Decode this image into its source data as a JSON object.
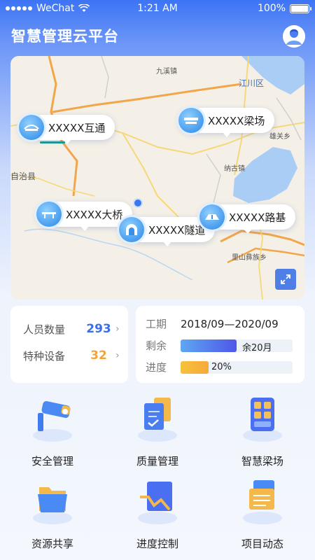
{
  "status_bar": {
    "carrier": "WeChat",
    "time": "1:21 AM",
    "battery": "100%"
  },
  "header": {
    "title": "智慧管理云平台"
  },
  "map": {
    "markers": [
      {
        "label": "XXXXX互通",
        "icon": "interchange-icon"
      },
      {
        "label": "XXXXX梁场",
        "icon": "beam-yard-icon"
      },
      {
        "label": "XXXXX大桥",
        "icon": "bridge-icon"
      },
      {
        "label": "XXXXX隧道",
        "icon": "tunnel-icon"
      },
      {
        "label": "XXXXX路基",
        "icon": "roadbed-icon"
      }
    ],
    "place_labels": [
      "九溪镇",
      "江川区",
      "雄关乡",
      "纳古镇",
      "自治县",
      "里山彝族乡"
    ]
  },
  "stats": {
    "personnel": {
      "label": "人员数量",
      "value": "293",
      "color": "#3b6fe8"
    },
    "equipment": {
      "label": "特种设备",
      "value": "32",
      "color": "#f2a33a"
    }
  },
  "project": {
    "period_label": "工期",
    "period_value": "2018/09—2020/09",
    "remaining_label": "剩余",
    "remaining_value": "余20月",
    "remaining_fraction": 0.5,
    "progress_label": "进度",
    "progress_value": "20%",
    "progress_fraction": 0.25
  },
  "modules": [
    {
      "label": "安全管理",
      "icon": "security-camera-icon"
    },
    {
      "label": "质量管理",
      "icon": "quality-document-icon"
    },
    {
      "label": "智慧梁场",
      "icon": "smart-beam-yard-icon"
    },
    {
      "label": "资源共享",
      "icon": "shared-folder-icon"
    },
    {
      "label": "进度控制",
      "icon": "progress-chart-icon"
    },
    {
      "label": "项目动态",
      "icon": "project-news-icon"
    }
  ]
}
